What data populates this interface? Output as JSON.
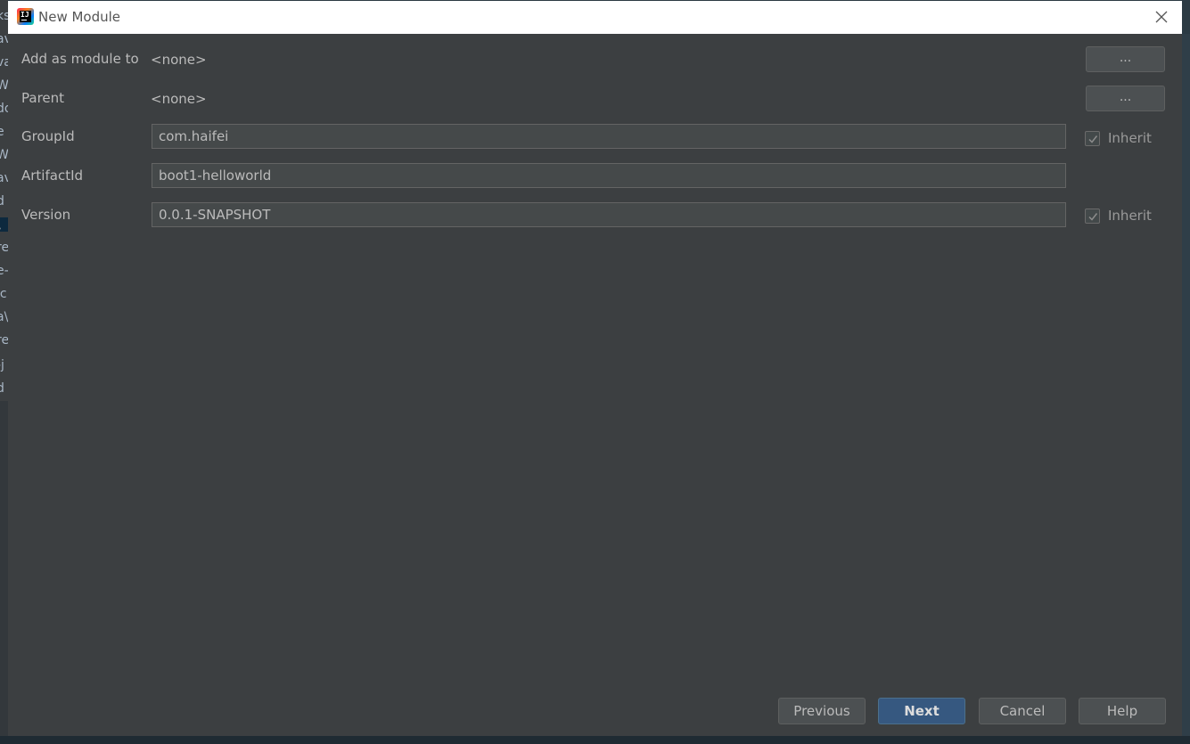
{
  "background": {
    "ide_fragments": [
      "ks",
      "av",
      "va",
      "W",
      "do",
      "e",
      "W",
      "av",
      "d",
      "\\",
      "re",
      "e-",
      "ic",
      "a\\",
      "re",
      "-j",
      "d"
    ]
  },
  "dialog": {
    "title": "New Module",
    "close_icon": "close-icon"
  },
  "form": {
    "add_as_module_to": {
      "label": "Add as module to",
      "value": "<none>",
      "browse_label": "..."
    },
    "parent": {
      "label": "Parent",
      "value": "<none>",
      "browse_label": "..."
    },
    "group_id": {
      "label": "GroupId",
      "value": "com.haifei",
      "inherit_label": "Inherit",
      "inherit_checked": true
    },
    "artifact_id": {
      "label": "ArtifactId",
      "value": "boot1-helloworld"
    },
    "version": {
      "label": "Version",
      "value": "0.0.1-SNAPSHOT",
      "inherit_label": "Inherit",
      "inherit_checked": true
    }
  },
  "buttons": {
    "previous": "Previous",
    "next": "Next",
    "cancel": "Cancel",
    "help": "Help"
  },
  "colors": {
    "dialog_bg": "#3c3f41",
    "field_bg": "#45494a",
    "primary_button": "#365880",
    "text": "#bbbbbb"
  }
}
